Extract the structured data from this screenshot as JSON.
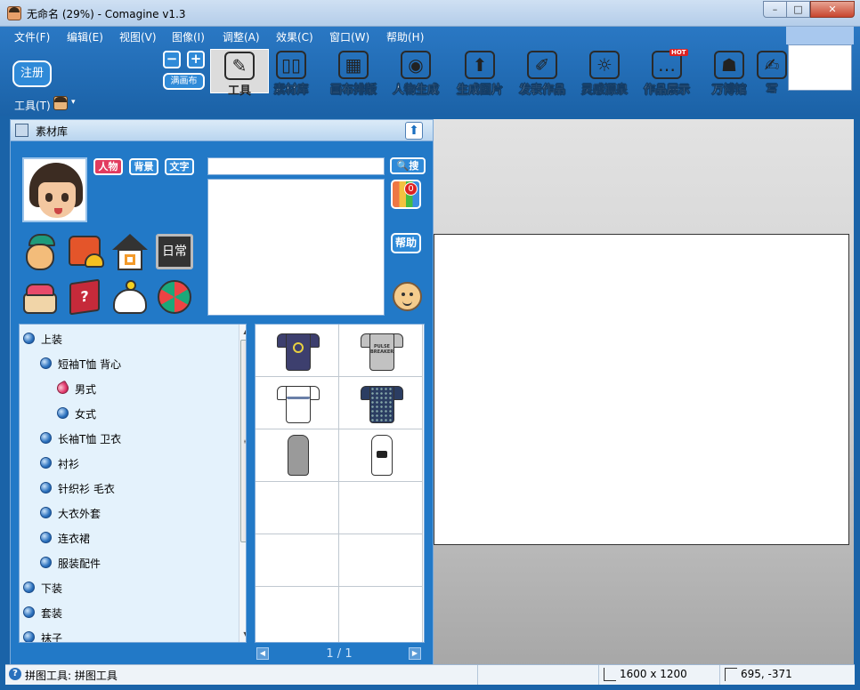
{
  "window": {
    "title": "无命名 (29%) - Comagine v1.3",
    "minimize": "–",
    "maximize": "□",
    "close": "✕"
  },
  "menu": [
    "文件(F)",
    "编辑(E)",
    "视图(V)",
    "图像(I)",
    "调整(A)",
    "效果(C)",
    "窗口(W)",
    "帮助(H)"
  ],
  "toolbar": {
    "register": "注册",
    "zoom_out": "−",
    "zoom_in": "+",
    "fit_canvas": "满画布",
    "tools": [
      {
        "label": "工具",
        "icon": "brush-ruler-icon",
        "glyph": "✎"
      },
      {
        "label": "素材库",
        "icon": "cabinet-icon",
        "glyph": "▯▯"
      },
      {
        "label": "画布排版",
        "icon": "layout-icon",
        "glyph": "▦"
      },
      {
        "label": "人物生成",
        "icon": "eye-icon",
        "glyph": "◉"
      },
      {
        "label": "生成图片",
        "icon": "image-export-icon",
        "glyph": "⬆"
      },
      {
        "label": "发表作品",
        "icon": "notebook-icon",
        "glyph": "✐"
      },
      {
        "label": "灵感源泉",
        "icon": "lightbulb-icon",
        "glyph": "☼"
      },
      {
        "label": "作品展示",
        "icon": "chat-bubble-icon",
        "glyph": "…"
      },
      {
        "label": "万博馆",
        "icon": "robot-icon",
        "glyph": "☗"
      },
      {
        "label": "写",
        "icon": "write-icon",
        "glyph": "✍"
      }
    ],
    "active_tool": "工具",
    "hot_badge": "HOT",
    "tool_dropdown": "工具(T)",
    "dropdown_caret": "▾"
  },
  "panel": {
    "title": "素材库",
    "collapse": "⬆",
    "tags": [
      "人物",
      "背景",
      "文字"
    ],
    "search": {
      "value": "",
      "button": "搜"
    },
    "palette_badge": "0",
    "help": "帮助",
    "daily": "日常",
    "mystery": "?"
  },
  "tree": {
    "items": [
      {
        "label": "上装",
        "level": 0
      },
      {
        "label": "短袖T恤 背心",
        "level": 1
      },
      {
        "label": "男式",
        "level": 2,
        "selected": true
      },
      {
        "label": "女式",
        "level": 2
      },
      {
        "label": "长袖T恤 卫衣",
        "level": 1
      },
      {
        "label": "衬衫",
        "level": 1
      },
      {
        "label": "针织衫 毛衣",
        "level": 1
      },
      {
        "label": "大衣外套",
        "level": 1
      },
      {
        "label": "连衣裙",
        "level": 1
      },
      {
        "label": "服装配件",
        "level": 1
      },
      {
        "label": "下装",
        "level": 0
      },
      {
        "label": "套装",
        "level": 0
      },
      {
        "label": "袜子",
        "level": 0
      }
    ],
    "scroll_up": "▲",
    "scroll_down": "▼",
    "thumb_grip": "≡"
  },
  "grid": {
    "items": [
      {
        "name": "navy-tshirt",
        "color": "#3d3f6e",
        "print": "",
        "tank": false
      },
      {
        "name": "grey-tshirt",
        "color": "#c2c2c2",
        "print": "PULSE BREAKERS",
        "tank": false
      },
      {
        "name": "white-tshirt",
        "color": "#ffffff",
        "print": "",
        "tank": false
      },
      {
        "name": "dotted-navy-tshirt",
        "color": "#2b3d62",
        "print": "",
        "tank": false
      },
      {
        "name": "grey-tank",
        "color": "#9a9a9a",
        "print": "",
        "tank": true
      },
      {
        "name": "white-tank",
        "color": "#ffffff",
        "print": "",
        "tank": true
      }
    ]
  },
  "pager": {
    "label": "1 / 1",
    "prev": "◀",
    "next": "▶"
  },
  "status": {
    "help_icon": "?",
    "text": "拼图工具: 拼图工具",
    "canvas_size": "1600 x 1200",
    "cursor": "695, -371"
  }
}
